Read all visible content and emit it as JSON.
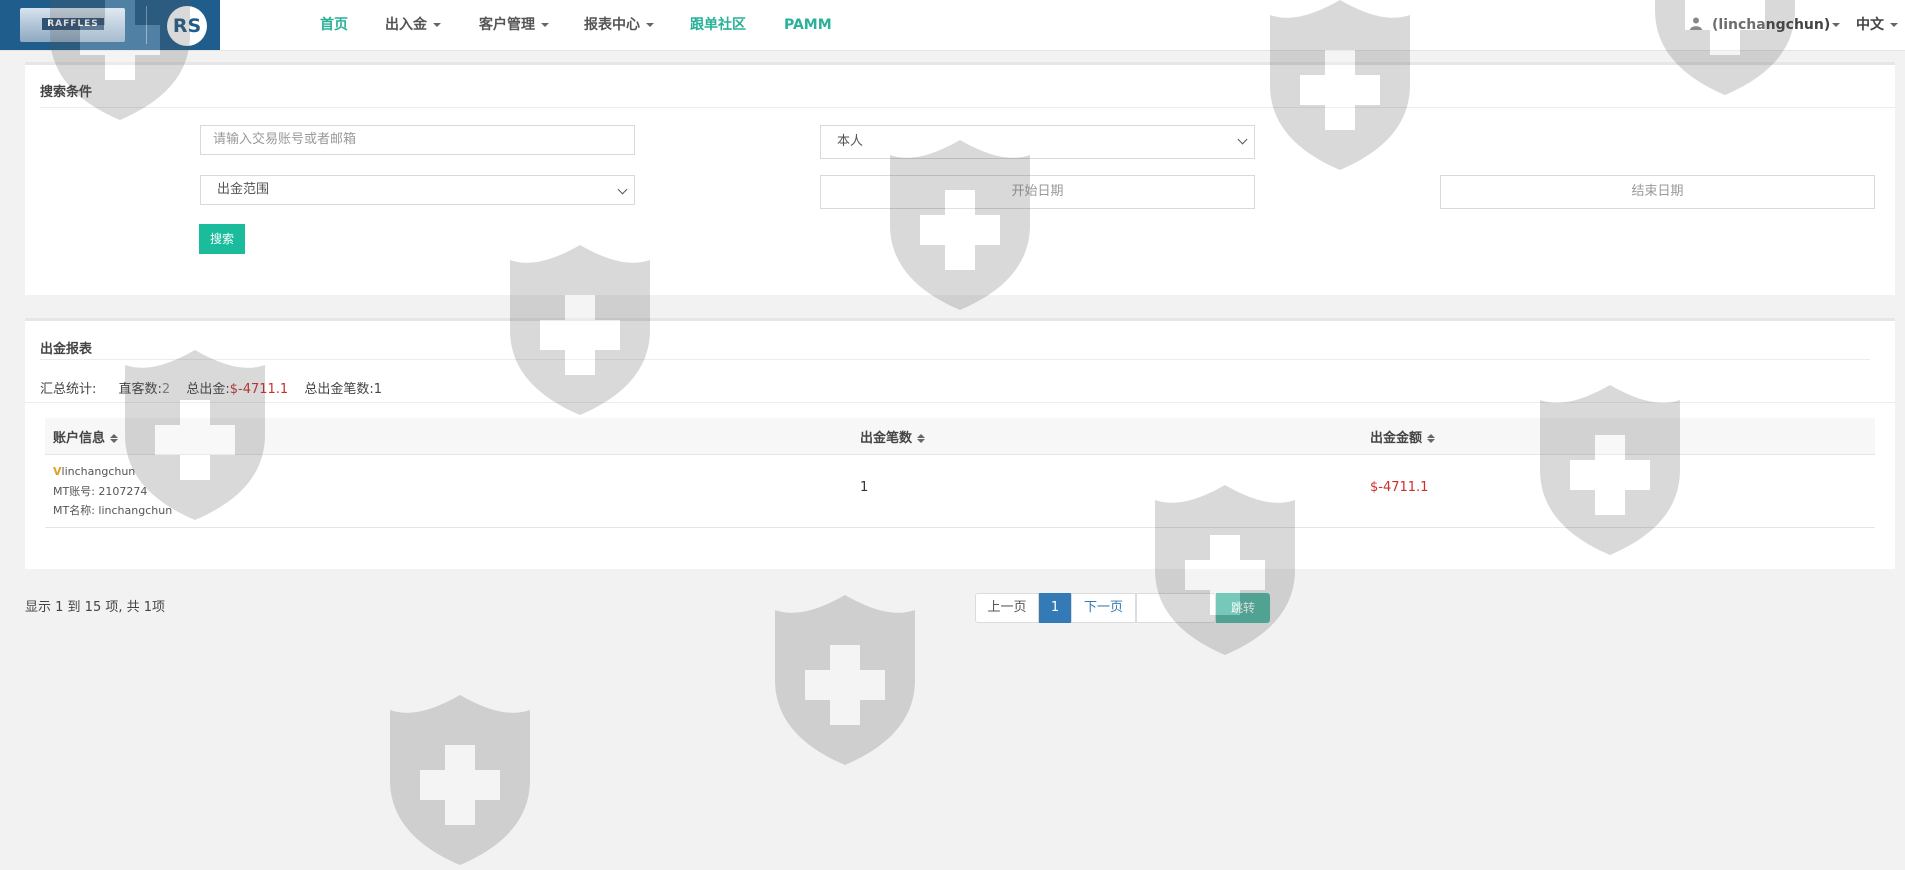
{
  "header": {
    "logo_sign": "RAFFLES",
    "logo_rs": "RS",
    "nav": [
      {
        "label": "首页",
        "dropdown": false,
        "active": true
      },
      {
        "label": "出入金",
        "dropdown": true,
        "active": false
      },
      {
        "label": "客户管理",
        "dropdown": true,
        "active": false
      },
      {
        "label": "报表中心",
        "dropdown": true,
        "active": false
      },
      {
        "label": "跟单社区",
        "dropdown": false,
        "active": true
      },
      {
        "label": "PAMM",
        "dropdown": false,
        "active": true
      }
    ],
    "user": "(linchangchun)",
    "language": "中文"
  },
  "search": {
    "title": "搜索条件",
    "account_placeholder": "请输入交易账号或者邮箱",
    "scope_value": "本人",
    "withdraw_range_value": "出金范围",
    "start_date_placeholder": "开始日期",
    "end_date_placeholder": "结束日期",
    "search_button": "搜索"
  },
  "report": {
    "title": "出金报表",
    "summary": {
      "label": "汇总统计:",
      "direct_label": "直客数:",
      "direct_value": "2",
      "total_label": "总出金:",
      "total_value": "$-4711.1",
      "count_label": "总出金笔数:",
      "count_value": "1"
    },
    "columns": [
      "账户信息",
      "出金笔数",
      "出金金额"
    ],
    "rows": [
      {
        "name": "linchangchun",
        "mt_account_label": "MT账号:",
        "mt_account": "2107274",
        "mt_name_label": "MT名称:",
        "mt_name": "linchangchun",
        "count": "1",
        "amount": "$-4711.1"
      }
    ]
  },
  "pagination": {
    "info": "显示 1 到 15 项, 共 1项",
    "prev": "上一页",
    "current": "1",
    "next": "下一页",
    "jump": "跳转"
  },
  "colors": {
    "accent_green": "#1abc9c",
    "nav_green": "#2ab197",
    "brand_blue": "#1f5d8c",
    "negative_red": "#c9302c",
    "page_blue": "#337ab7"
  }
}
